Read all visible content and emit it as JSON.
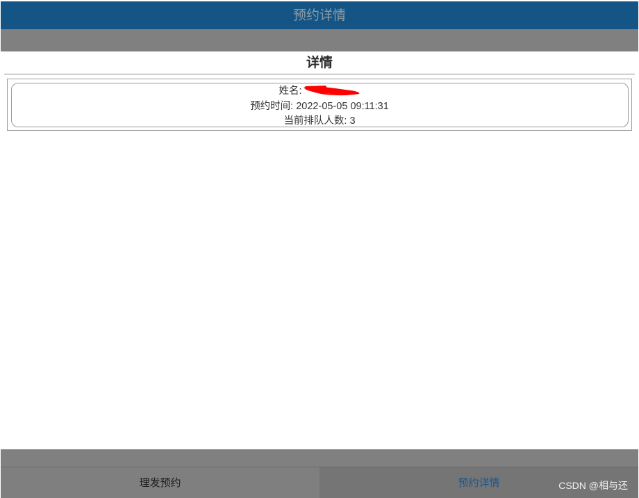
{
  "header": {
    "title": "预约详情"
  },
  "section": {
    "title": "详情"
  },
  "details": {
    "name_label": "姓名:",
    "time_text": "预约时间: 2022-05-05 09:11:31",
    "queue_text": "当前排队人数: 3"
  },
  "tabs": [
    {
      "label": "理发预约"
    },
    {
      "label": "预约详情"
    }
  ],
  "watermark": "CSDN @相与还",
  "colors": {
    "header_bg": "#145586",
    "active_tab_text": "#1a5690",
    "strip_gray": "#808080"
  }
}
